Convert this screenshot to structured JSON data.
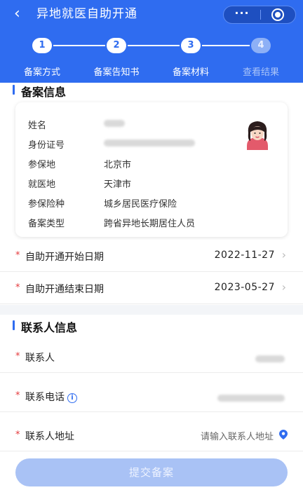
{
  "header": {
    "back_icon": "chevron-left-icon",
    "title": "异地就医自助开通",
    "more_label": "···",
    "brand_color": "#2f6cf0"
  },
  "steps": [
    {
      "number": "1",
      "label": "备案方式",
      "active": true
    },
    {
      "number": "2",
      "label": "备案告知书",
      "active": true
    },
    {
      "number": "3",
      "label": "备案材料",
      "active": true
    },
    {
      "number": "4",
      "label": "查看结果",
      "active": false
    }
  ],
  "filing_info": {
    "heading": "备案信息",
    "rows": [
      {
        "key": "姓名",
        "value": ""
      },
      {
        "key": "身份证号",
        "value": ""
      },
      {
        "key": "参保地",
        "value": "北京市"
      },
      {
        "key": "就医地",
        "value": "天津市"
      },
      {
        "key": "参保险种",
        "value": "城乡居民医疗保险"
      },
      {
        "key": "备案类型",
        "value": "跨省异地长期居住人员"
      }
    ]
  },
  "dates": {
    "start_label": "自助开通开始日期",
    "start_value": "2022-11-27",
    "end_label": "自助开通结束日期",
    "end_value": "2023-05-27"
  },
  "contact": {
    "heading": "联系人信息",
    "name_label": "联系人",
    "phone_label": "联系电话",
    "address_label": "联系人地址",
    "address_placeholder": "请输入联系人地址"
  },
  "submit_label": "提交备案",
  "required_mark": "*"
}
